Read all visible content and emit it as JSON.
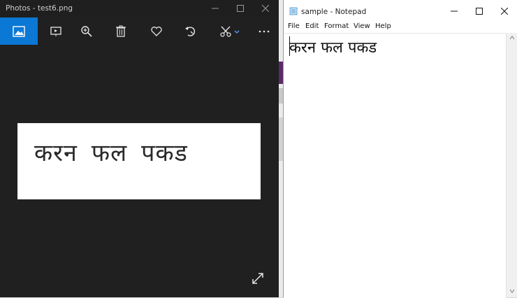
{
  "photos": {
    "title": "Photos - test6.png",
    "toolbar": [
      "view-all-photos-icon",
      "slideshow-icon",
      "zoom-icon",
      "delete-icon",
      "favorite-icon",
      "rotate-icon",
      "edit-create-icon",
      "more-icon"
    ],
    "image_text": [
      "करन",
      "फल",
      "पकड"
    ]
  },
  "notepad": {
    "title": "sample - Notepad",
    "menu": [
      "File",
      "Edit",
      "Format",
      "View",
      "Help"
    ],
    "content": "करन फल पकड"
  },
  "colors": {
    "photos_bg": "#202020",
    "accent": "#0b78d6",
    "notepad_bg": "#ffffff"
  }
}
